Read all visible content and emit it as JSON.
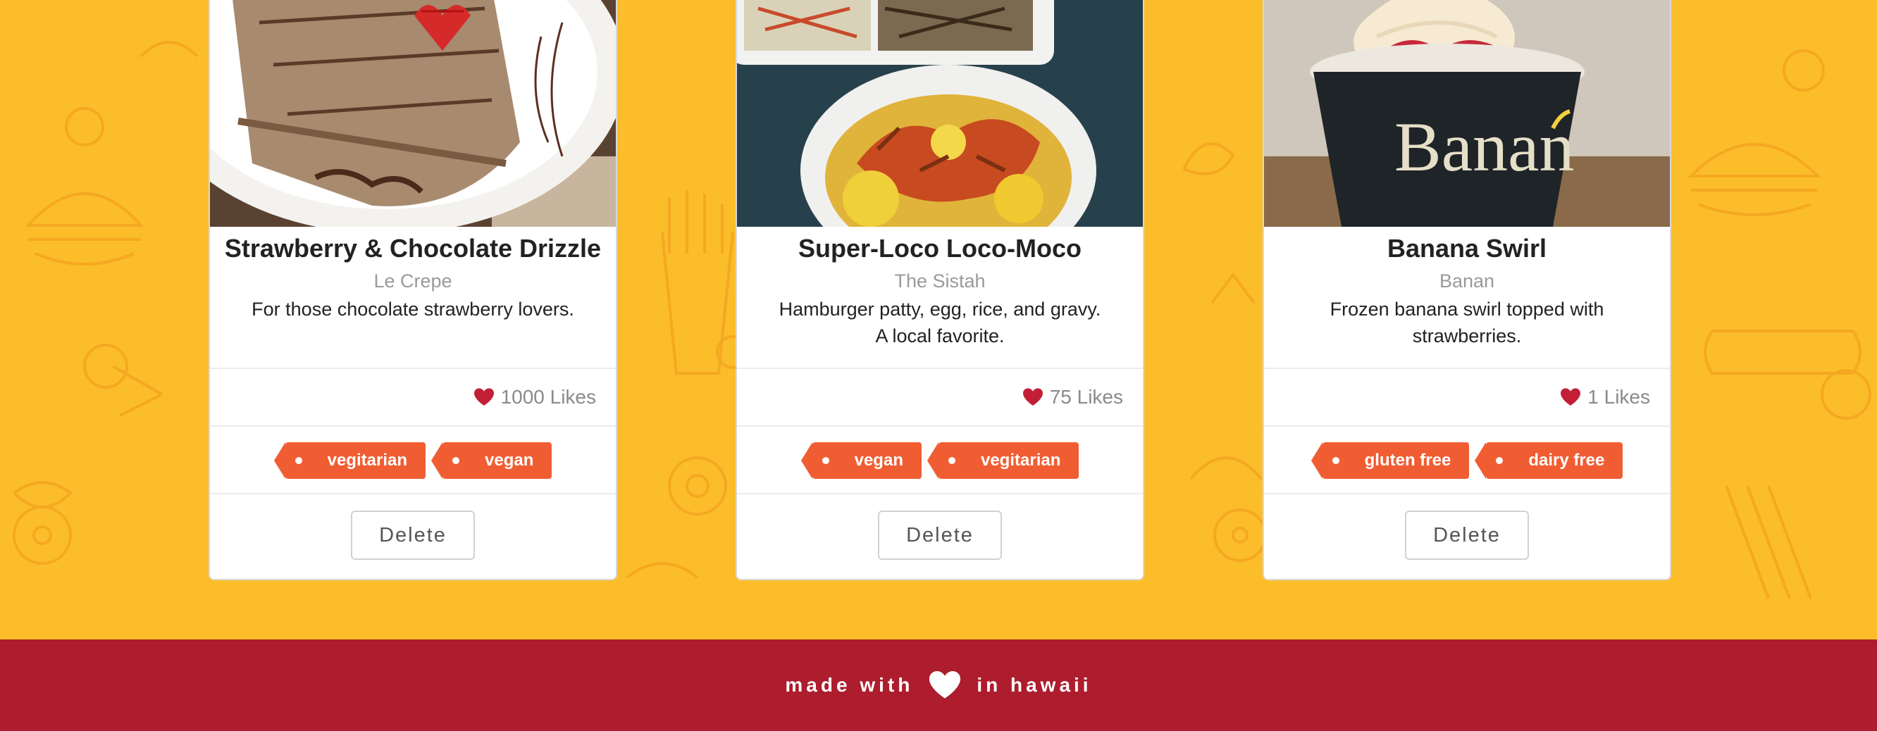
{
  "cards": [
    {
      "title": "Strawberry & Chocolate Drizzle",
      "vendor": "Le Crepe",
      "description": "For those chocolate strawberry lovers.",
      "likes": "1000 Likes",
      "tags": [
        "vegitarian",
        "vegan"
      ],
      "delete_label": "Delete"
    },
    {
      "title": "Super-Loco Loco-Moco",
      "vendor": "The Sistah",
      "description": "Hamburger patty, egg, rice, and gravy. A local favorite.",
      "likes": "75 Likes",
      "tags": [
        "vegan",
        "vegitarian"
      ],
      "delete_label": "Delete"
    },
    {
      "title": "Banana Swirl",
      "vendor": "Banan",
      "description": "Frozen banana swirl topped with strawberries.",
      "likes": "1 Likes",
      "tags": [
        "gluten free",
        "dairy free"
      ],
      "delete_label": "Delete",
      "image_cup_text": "Banan"
    }
  ],
  "footer": {
    "text_before": "made with",
    "text_after": "in hawaii",
    "heart_icon": "heart-icon"
  },
  "colors": {
    "background": "#fcbd2b",
    "footer": "#ad1d2d",
    "tag": "#f15d32",
    "heart": "#c21f36"
  }
}
